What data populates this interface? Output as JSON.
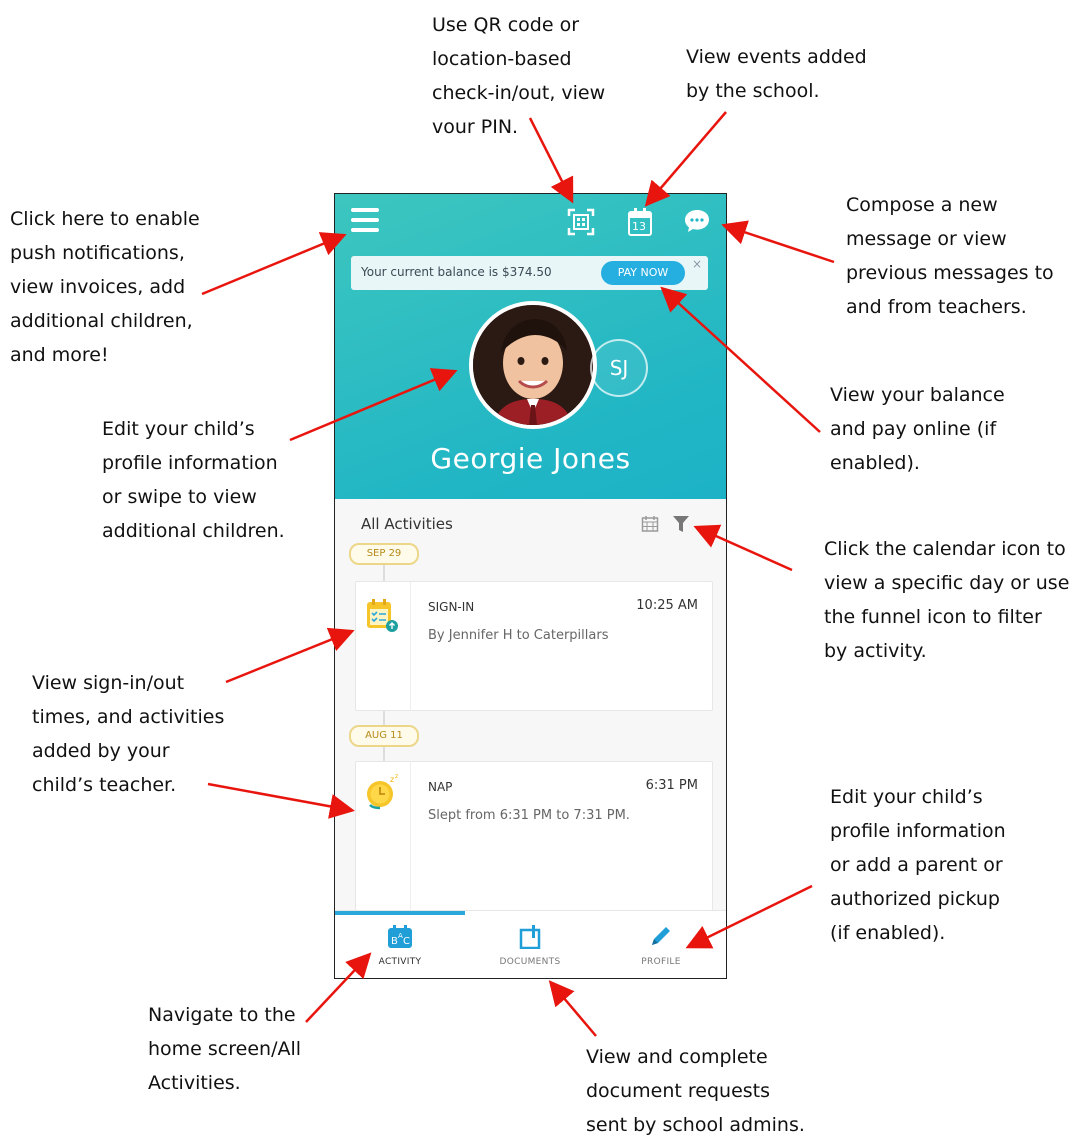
{
  "callouts": {
    "menu": "Click here to enable\npush notifications,\nview invoices, add\nadditional children,\nand more!",
    "qr": "Use QR code or\nlocation-based\ncheck-in/out, view\nvour PIN.",
    "events": "View events added\nby the school.",
    "messages": "Compose a new\nmessage or view\nprevious messages to\nand from teachers.",
    "profile_edit": "Edit your child’s\nprofile information\nor swipe to view\nadditional children.",
    "balance": "View your balance\nand pay online (if\nenabled).",
    "calendar_filter": "Click the calendar icon to\nview a specific day or use\nthe funnel icon to filter\nby activity.",
    "timeline": "View sign-in/out\ntimes, and activities\nadded by your\nchild’s teacher.",
    "profile_tab": "Edit your child’s\nprofile information\nor add a parent or\nauthorized pickup\n(if enabled).",
    "activity_tab": "Navigate to the\nhome screen/All\nActivities.",
    "documents_tab": "View and complete\ndocument requests\nsent by school admins."
  },
  "app": {
    "balance_text": "Your current balance is $374.50",
    "pay_button": "PAY NOW",
    "close": "×",
    "secondary_avatar": "SJ",
    "child_name": "Georgie Jones",
    "section_title": "All Activities",
    "calendar_day": "13",
    "entries": [
      {
        "date": "SEP 29",
        "title": "SIGN-IN",
        "time": "10:25 AM",
        "desc": "By Jennifer H to Caterpillars"
      },
      {
        "date": "AUG 11",
        "title": "NAP",
        "time": "6:31 PM",
        "desc": "Slept from 6:31 PM to 7:31 PM."
      }
    ],
    "tabs": [
      {
        "label": "ACTIVITY"
      },
      {
        "label": "DOCUMENTS"
      },
      {
        "label": "PROFILE"
      }
    ],
    "colors": {
      "teal": "#21b6c5",
      "accent": "#25aee0",
      "arrow": "#e8150e"
    }
  }
}
